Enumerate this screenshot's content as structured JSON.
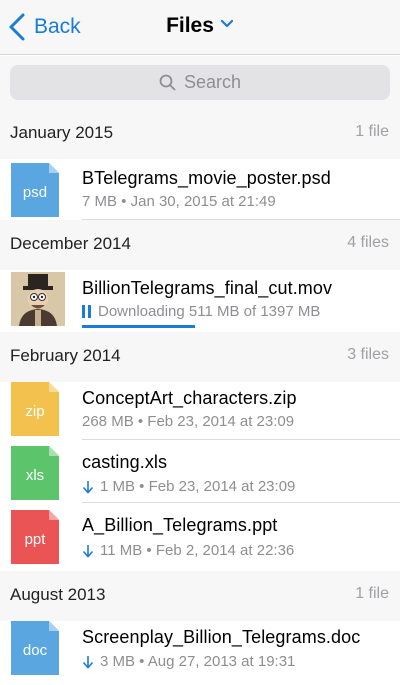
{
  "navbar": {
    "back_label": "Back",
    "title": "Files",
    "accent_color": "#1a7bd9"
  },
  "search": {
    "placeholder": "Search"
  },
  "sections": [
    {
      "name": "January 2015",
      "count": "1 file",
      "files": [
        {
          "name": "BTelegrams_movie_poster.psd",
          "ext": "psd",
          "meta": "7 MB • Jan 30, 2015 at 21:49",
          "icon_color": "#5aa6e0"
        }
      ]
    },
    {
      "name": "December 2014",
      "count": "4 files",
      "files": [
        {
          "name": "BillionTelegrams_final_cut.mov",
          "meta": "Downloading 511 MB of 1397 MB",
          "progress": 0.366,
          "thumbnail": "movie-thumbnail"
        }
      ]
    },
    {
      "name": "February 2014",
      "count": "3 files",
      "files": [
        {
          "name": "ConceptArt_characters.zip",
          "ext": "zip",
          "meta": "268 MB • Feb 23, 2014 at 23:09",
          "icon_color": "#f2c14e"
        },
        {
          "name": "casting.xls",
          "ext": "xls",
          "meta": "1 MB • Feb 23, 2014 at 23:09",
          "icon_color": "#5cc46a",
          "downloaded": true
        },
        {
          "name": "A_Billion_Telegrams.ppt",
          "ext": "ppt",
          "meta": "11 MB • Feb 2, 2014 at 22:36",
          "icon_color": "#ea5454",
          "downloaded": true
        }
      ]
    },
    {
      "name": "August 2013",
      "count": "1 file",
      "files": [
        {
          "name": "Screenplay_Billion_Telegrams.doc",
          "ext": "doc",
          "meta": "3 MB • Aug 27, 2013 at 19:31",
          "icon_color": "#5aa6e0",
          "downloaded": true
        }
      ]
    }
  ]
}
